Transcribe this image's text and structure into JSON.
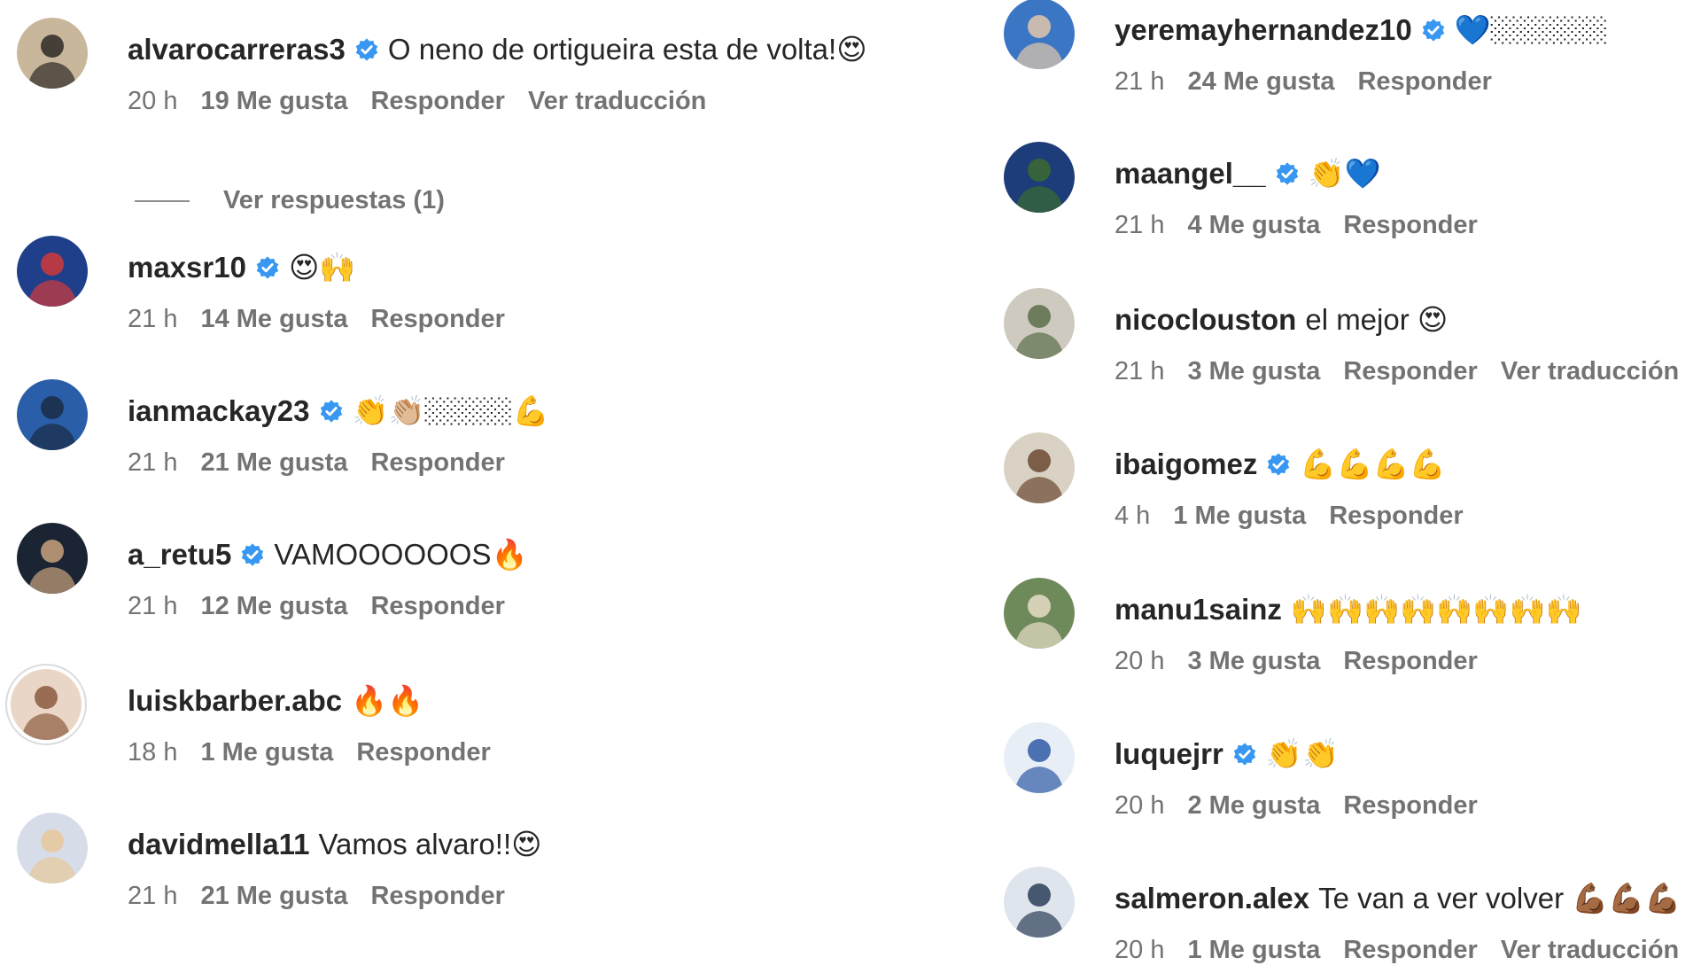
{
  "left_comments": [
    {
      "username": "alvarocarreras3",
      "verified": true,
      "text": "O neno de ortigueira esta de volta!😍",
      "time": "20 h",
      "likes": "19 Me gusta",
      "reply": "Responder",
      "translate": "Ver traducción",
      "replies": "Ver respuestas (1)",
      "avatar_bg": "#c9b79c",
      "avatar_fg": "#2e2a26"
    },
    {
      "username": "maxsr10",
      "verified": true,
      "text": "😍🙌",
      "time": "21 h",
      "likes": "14 Me gusta",
      "reply": "Responder",
      "avatar_bg": "#1f3f8a",
      "avatar_fg": "#d13a3a"
    },
    {
      "username": "ianmackay23",
      "verified": true,
      "text": "👏👏🏼🏼🏼🏼💪",
      "time": "21 h",
      "likes": "21 Me gusta",
      "reply": "Responder",
      "avatar_bg": "#2a5ea8",
      "avatar_fg": "#1b2b45"
    },
    {
      "username": "a_retu5",
      "verified": true,
      "text": "VAMOOOOOOS🔥",
      "time": "21 h",
      "likes": "12 Me gusta",
      "reply": "Responder",
      "avatar_bg": "#1b2433",
      "avatar_fg": "#c9a27c"
    },
    {
      "username": "luiskbarber.abc",
      "verified": false,
      "text": "🔥🔥",
      "time": "18 h",
      "likes": "1 Me gusta",
      "reply": "Responder",
      "avatar_bg": "#e9d6c6",
      "avatar_fg": "#8a5b3f"
    },
    {
      "username": "davidmella11",
      "verified": false,
      "text": "Vamos alvaro!!😍",
      "time": "21 h",
      "likes": "21 Me gusta",
      "reply": "Responder",
      "avatar_bg": "#d7dde8",
      "avatar_fg": "#e7c79a"
    }
  ],
  "right_comments": [
    {
      "username": "yeremayhernandez10",
      "verified": true,
      "text": "💙🏼🏼🏼🏼",
      "time": "21 h",
      "likes": "24 Me gusta",
      "reply": "Responder",
      "avatar_bg": "#3a76c4",
      "avatar_fg": "#e3c7ab"
    },
    {
      "username": "maangel__",
      "verified": true,
      "text": "👏💙",
      "time": "21 h",
      "likes": "4 Me gusta",
      "reply": "Responder",
      "avatar_bg": "#1d3c7a",
      "avatar_fg": "#3b6a2f"
    },
    {
      "username": "nicoclouston",
      "verified": false,
      "text": "el mejor 😍",
      "time": "21 h",
      "likes": "3 Me gusta",
      "reply": "Responder",
      "translate": "Ver traducción",
      "avatar_bg": "#cfcac0",
      "avatar_fg": "#5a6f4a"
    },
    {
      "username": "ibaigomez",
      "verified": true,
      "text": "💪💪💪💪",
      "time": "4 h",
      "likes": "1 Me gusta",
      "reply": "Responder",
      "avatar_bg": "#d9d1c4",
      "avatar_fg": "#6b4a33"
    },
    {
      "username": "manu1sainz",
      "verified": false,
      "text": "🙌🙌🙌🙌🙌🙌🙌🙌",
      "time": "20 h",
      "likes": "3 Me gusta",
      "reply": "Responder",
      "avatar_bg": "#6f8a5a",
      "avatar_fg": "#e8ddc8"
    },
    {
      "username": "luquejrr",
      "verified": true,
      "text": "👏👏",
      "time": "20 h",
      "likes": "2 Me gusta",
      "reply": "Responder",
      "avatar_bg": "#e8eef6",
      "avatar_fg": "#2f5aa6"
    },
    {
      "username": "salmeron.alex",
      "verified": false,
      "text": "Te van a ver volver 💪🏾💪🏾💪🏾",
      "time": "20 h",
      "likes": "1 Me gusta",
      "reply": "Responder",
      "translate": "Ver traducción",
      "avatar_bg": "#dfe5ec",
      "avatar_fg": "#2c3e5a"
    }
  ],
  "colors": {
    "verified_badge": "#3897f0",
    "meta_text": "#737373",
    "username": "#262626"
  },
  "icons": {
    "verified": "verified-badge-icon"
  }
}
